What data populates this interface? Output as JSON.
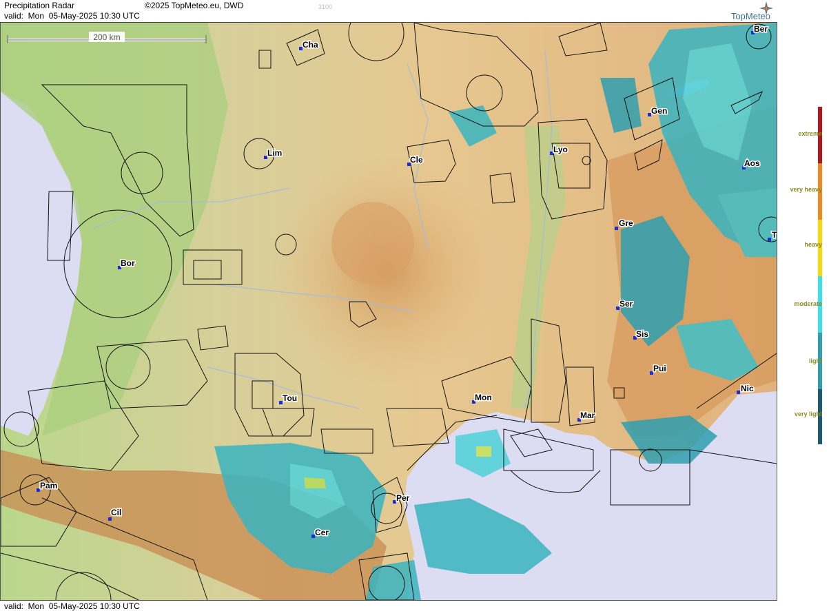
{
  "header": {
    "title": "Precipitation Radar",
    "valid_label": "valid:  Mon  05-May-2025 10:30 UTC",
    "copyright": "©2025 TopMeteo.eu, DWD",
    "code": "3100",
    "logo": "TopMeteo"
  },
  "footer": {
    "valid_label": "valid:  Mon  05-May-2025 10:30 UTC"
  },
  "map": {
    "scale_label": "200 km",
    "cities": [
      {
        "name": "Cha"
      },
      {
        "name": "Ber"
      },
      {
        "name": "Gen"
      },
      {
        "name": "Lim"
      },
      {
        "name": "Cle"
      },
      {
        "name": "Lyo"
      },
      {
        "name": "Aos"
      },
      {
        "name": "Gre"
      },
      {
        "name": "Bor"
      },
      {
        "name": "Ser"
      },
      {
        "name": "Sis"
      },
      {
        "name": "Pui"
      },
      {
        "name": "Tou"
      },
      {
        "name": "Mon"
      },
      {
        "name": "Nic"
      },
      {
        "name": "Mar"
      },
      {
        "name": "Pam"
      },
      {
        "name": "Per"
      },
      {
        "name": "Cil"
      },
      {
        "name": "Cer"
      },
      {
        "name": "T"
      }
    ]
  },
  "legend": {
    "items": [
      {
        "label": "extreme",
        "color": "#b2141c"
      },
      {
        "label": "very heavy",
        "color": "#f08a1e"
      },
      {
        "label": "heavy",
        "color": "#f8d80a"
      },
      {
        "label": "moderate",
        "color": "#3ce0e8"
      },
      {
        "label": "light",
        "color": "#2f9fb0"
      },
      {
        "label": "very light",
        "color": "#1d5a72"
      }
    ]
  }
}
